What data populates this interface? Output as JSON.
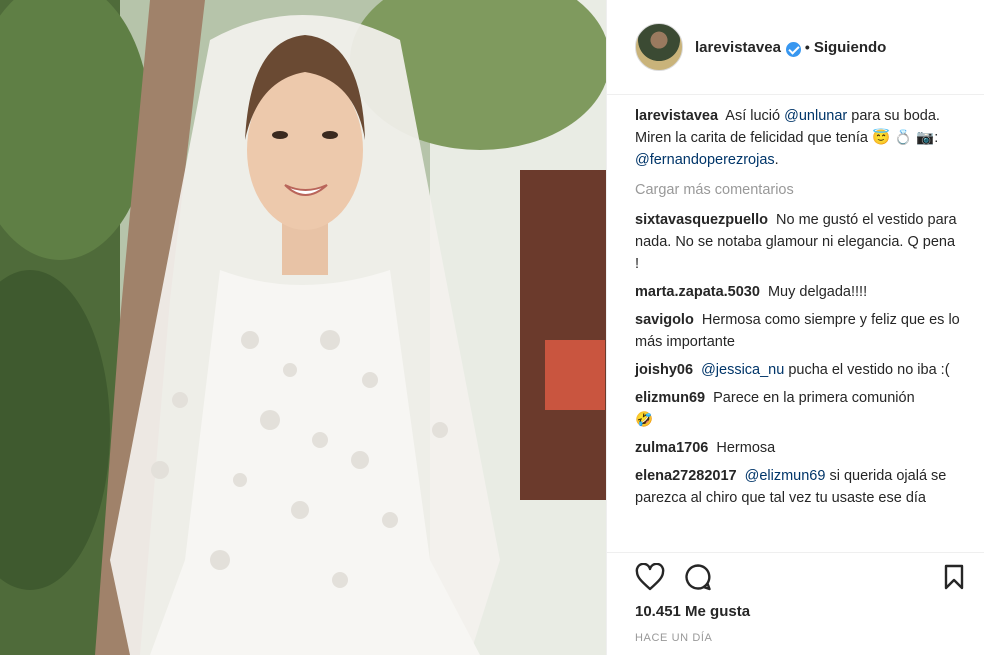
{
  "post": {
    "username": "larevistavea",
    "follow_status": "Siguiendo",
    "separator": "•"
  },
  "caption": {
    "username": "larevistavea",
    "text_1": "Así lució",
    "mention_1": "@unlunar",
    "text_2": "para su boda. Miren la carita de felicidad que tenía",
    "emoji": "😇 💍 📷:",
    "mention_2": "@fernandoperezrojas",
    "text_3": "."
  },
  "load_more": "Cargar más comentarios",
  "comments": [
    {
      "user": "sixtavasquezpuello",
      "text": "No me gustó el vestido para nada. No se notaba glamour ni elegancia. Q pena !"
    },
    {
      "user": "marta.zapata.5030",
      "text": "Muy delgada!!!!"
    },
    {
      "user": "savigolo",
      "text": "Hermosa como siempre y feliz que es lo más importante"
    },
    {
      "user": "joishy06",
      "mention": "@jessica_nu",
      "text": "pucha el vestido no iba :("
    },
    {
      "user": "elizmun69",
      "text": "Parece en la primera comunión",
      "emoji": "🤣"
    },
    {
      "user": "zulma1706",
      "text": "Hermosa"
    },
    {
      "user": "elena27282017",
      "mention": "@elizmun69",
      "text": "si querida ojalá se parezca al chiro que tal vez tu usaste ese día"
    }
  ],
  "actions": {
    "like_icon": "heart-icon",
    "comment_icon": "speech-bubble-icon",
    "save_icon": "bookmark-icon"
  },
  "likes": "10.451 Me gusta",
  "timestamp": "Hace un día",
  "colors": {
    "mention": "#003569",
    "verified": "#3897f0",
    "muted": "#999999",
    "text": "#262626"
  }
}
